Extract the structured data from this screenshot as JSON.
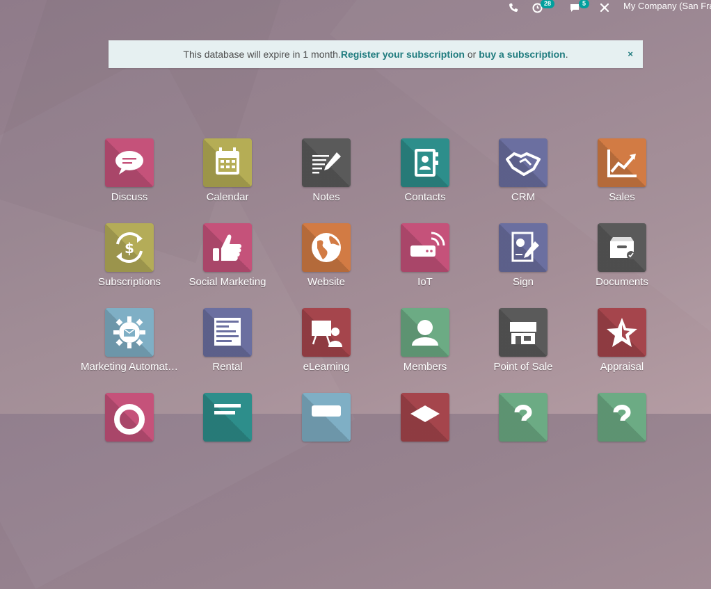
{
  "topbar": {
    "activity_badge": "28",
    "messages_badge": "5",
    "company": "My Company (San Fra"
  },
  "banner": {
    "text_before": "This database will expire in 1 month. ",
    "register_link": "Register your subscription",
    "text_middle": " or ",
    "buy_link": "buy a subscription",
    "text_after": ".",
    "close": "×"
  },
  "apps": [
    {
      "label": "Discuss",
      "color": "#c5527a",
      "icon": "chat-bubble-icon"
    },
    {
      "label": "Calendar",
      "color": "#b5ad55",
      "icon": "calendar-icon"
    },
    {
      "label": "Notes",
      "color": "#5a5a5a",
      "icon": "notes-icon"
    },
    {
      "label": "Contacts",
      "color": "#2d8e8b",
      "icon": "address-book-icon"
    },
    {
      "label": "CRM",
      "color": "#6b6fa0",
      "icon": "handshake-icon"
    },
    {
      "label": "Sales",
      "color": "#d27b44",
      "icon": "line-chart-icon"
    },
    {
      "label": "Subscriptions",
      "color": "#b4ac58",
      "icon": "dollar-refresh-icon"
    },
    {
      "label": "Social Marketing",
      "color": "#c5527a",
      "icon": "thumbs-up-icon"
    },
    {
      "label": "Website",
      "color": "#d27b44",
      "icon": "globe-icon"
    },
    {
      "label": "IoT",
      "color": "#c5527a",
      "icon": "iot-device-icon"
    },
    {
      "label": "Sign",
      "color": "#6b6fa0",
      "icon": "sign-document-icon"
    },
    {
      "label": "Documents",
      "color": "#5a5a5a",
      "icon": "archive-box-icon"
    },
    {
      "label": "Marketing Automat…",
      "color": "#7fafc5",
      "icon": "gear-mail-icon"
    },
    {
      "label": "Rental",
      "color": "#6b6fa0",
      "icon": "rental-table-icon"
    },
    {
      "label": "eLearning",
      "color": "#a5454c",
      "icon": "teacher-board-icon"
    },
    {
      "label": "Members",
      "color": "#6cab84",
      "icon": "user-icon"
    },
    {
      "label": "Point of Sale",
      "color": "#5a5a5a",
      "icon": "shop-icon"
    },
    {
      "label": "Appraisal",
      "color": "#a5454c",
      "icon": "star-icon"
    },
    {
      "label": "",
      "color": "#c5527a",
      "icon": "lifebuoy-icon"
    },
    {
      "label": "",
      "color": "#2d8e8b",
      "icon": "list-icon"
    },
    {
      "label": "",
      "color": "#7fafc5",
      "icon": "card-icon"
    },
    {
      "label": "",
      "color": "#a5454c",
      "icon": "box-icon"
    },
    {
      "label": "",
      "color": "#6cab84",
      "icon": "help-icon"
    },
    {
      "label": "",
      "color": "#6cab84",
      "icon": "help-icon"
    }
  ]
}
